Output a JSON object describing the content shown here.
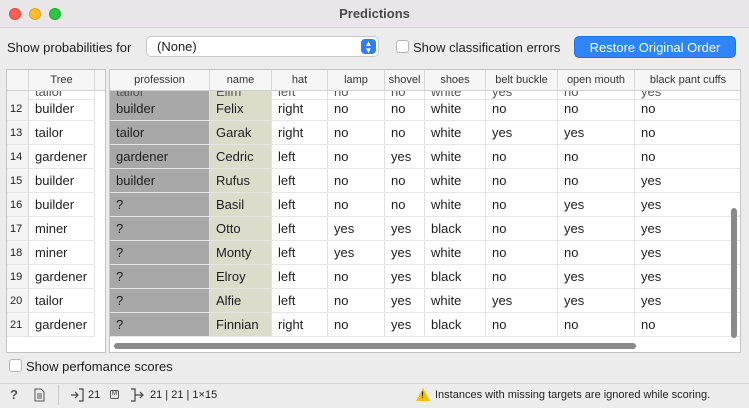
{
  "window": {
    "title": "Predictions"
  },
  "toolbar": {
    "show_probabilities_label": "Show probabilities for",
    "probabilities_value": "(None)",
    "show_errors_label": "Show classification errors",
    "restore_button": "Restore Original Order"
  },
  "left_table": {
    "header": "Tree",
    "clipped_row": "tailor",
    "rows": [
      {
        "num": "12",
        "value": "builder"
      },
      {
        "num": "13",
        "value": "tailor"
      },
      {
        "num": "14",
        "value": "gardener"
      },
      {
        "num": "15",
        "value": "builder"
      },
      {
        "num": "16",
        "value": "builder"
      },
      {
        "num": "17",
        "value": "miner"
      },
      {
        "num": "18",
        "value": "miner"
      },
      {
        "num": "19",
        "value": "gardener"
      },
      {
        "num": "20",
        "value": "tailor"
      },
      {
        "num": "21",
        "value": "gardener"
      }
    ]
  },
  "data_table": {
    "columns": [
      "profession",
      "name",
      "hat",
      "lamp",
      "shovel",
      "shoes",
      "belt buckle",
      "open mouth",
      "black pant cuffs"
    ],
    "clipped_row": [
      "tailor",
      "Elim",
      "left",
      "no",
      "no",
      "white",
      "yes",
      "no",
      "yes"
    ],
    "rows": [
      [
        "builder",
        "Felix",
        "right",
        "no",
        "no",
        "white",
        "no",
        "no",
        "no"
      ],
      [
        "tailor",
        "Garak",
        "right",
        "no",
        "no",
        "white",
        "yes",
        "yes",
        "no"
      ],
      [
        "gardener",
        "Cedric",
        "left",
        "no",
        "yes",
        "white",
        "no",
        "no",
        "no"
      ],
      [
        "builder",
        "Rufus",
        "left",
        "no",
        "no",
        "white",
        "no",
        "no",
        "yes"
      ],
      [
        "?",
        "Basil",
        "left",
        "no",
        "no",
        "white",
        "no",
        "yes",
        "yes"
      ],
      [
        "?",
        "Otto",
        "left",
        "yes",
        "yes",
        "black",
        "no",
        "yes",
        "yes"
      ],
      [
        "?",
        "Monty",
        "left",
        "yes",
        "yes",
        "white",
        "no",
        "no",
        "yes"
      ],
      [
        "?",
        "Elroy",
        "left",
        "no",
        "yes",
        "black",
        "no",
        "yes",
        "yes"
      ],
      [
        "?",
        "Alfie",
        "left",
        "no",
        "yes",
        "white",
        "yes",
        "yes",
        "yes"
      ],
      [
        "?",
        "Finnian",
        "right",
        "no",
        "yes",
        "black",
        "no",
        "no",
        "no"
      ]
    ]
  },
  "footer": {
    "show_performance_label": "Show perfomance scores"
  },
  "statusbar": {
    "help_icon": "?",
    "input_count": "21",
    "output_counts": "21 | 21 | 1×15",
    "warning": "Instances with missing targets are ignored while scoring."
  },
  "colors": {
    "accent": "#2f84f7",
    "target_column": "#a8a8a8",
    "meta_column": "#dcdccb"
  }
}
